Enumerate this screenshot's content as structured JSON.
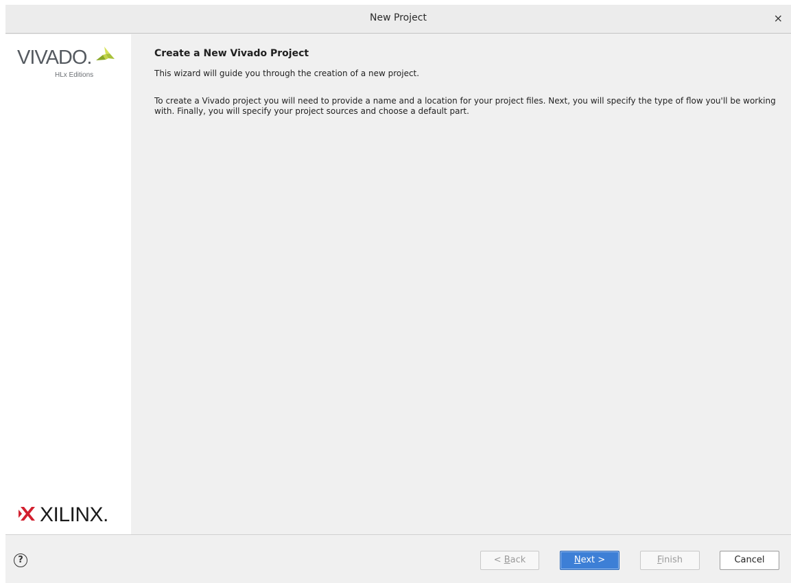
{
  "window": {
    "title": "New Project",
    "close_label": "×"
  },
  "sidebar": {
    "vivado_logo_text": "VIVADO.",
    "vivado_logo_subtitle": "HLx Editions",
    "xilinx_logo_text": "XILINX."
  },
  "content": {
    "heading": "Create a New Vivado Project",
    "intro": "This wizard will guide you through the creation of a new project.",
    "details": "To create a Vivado project you will need to provide a name and a location for your project files. Next, you will specify the type of flow you'll be working with. Finally, you will specify your project sources and choose a default part."
  },
  "footer": {
    "help_label": "?",
    "back": {
      "prefix": "< ",
      "mnemonic": "B",
      "rest": "ack",
      "enabled": false
    },
    "next": {
      "mnemonic": "N",
      "rest": "ext >",
      "enabled": true
    },
    "finish": {
      "mnemonic": "F",
      "rest": "inish",
      "enabled": false
    },
    "cancel": {
      "label": "Cancel",
      "enabled": true
    }
  },
  "colors": {
    "accent": "#3d7fd6",
    "vivado_leaf_dark": "#8aa828",
    "vivado_leaf_light": "#d6e25a",
    "xilinx_red": "#d2202f"
  },
  "icons": {
    "close": "close-icon",
    "help": "help-icon",
    "vivado": "vivado-logo-icon",
    "xilinx": "xilinx-logo-icon"
  }
}
